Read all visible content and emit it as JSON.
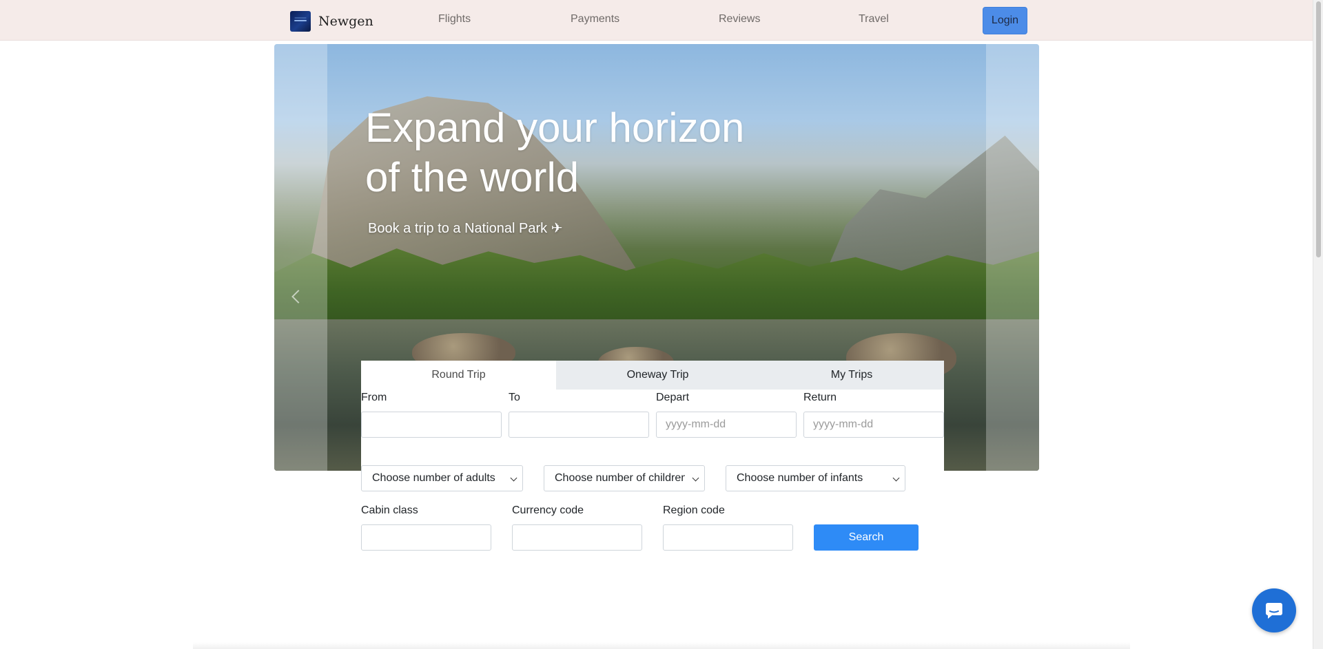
{
  "navbar": {
    "brand": "Newgen",
    "links": [
      "Flights",
      "Payments",
      "Reviews",
      "Travel"
    ],
    "login_label": "Login"
  },
  "hero": {
    "title": "Expand your horizon of the world",
    "subtitle": "Book a trip to a National Park ✈"
  },
  "booking": {
    "tabs": [
      "Round Trip",
      "Oneway Trip",
      "My Trips"
    ],
    "active_tab": "Round Trip",
    "from": {
      "label": "From",
      "value": "",
      "placeholder": ""
    },
    "to": {
      "label": "To",
      "value": "",
      "placeholder": ""
    },
    "depart": {
      "label": "Depart",
      "placeholder": "yyyy-mm-dd"
    },
    "return": {
      "label": "Return",
      "placeholder": "yyyy-mm-dd"
    },
    "adults_select": "Choose number of adults",
    "children_select": "Choose number of children",
    "infants_select": "Choose number of infants",
    "cabin_class": {
      "label": "Cabin class",
      "value": ""
    },
    "currency_code": {
      "label": "Currency code",
      "value": ""
    },
    "region_code": {
      "label": "Region code",
      "value": ""
    },
    "search_label": "Search"
  },
  "colors": {
    "navbar_bg": "#f5ebe9",
    "login_bg": "#4c8ce8",
    "search_bg": "#2e8bf6",
    "chat_bg": "#1f6fd6"
  },
  "icons": {
    "brand": "airline-logo-icon",
    "chat": "chat-bubble-icon",
    "carousel_prev": "chevron-left-icon"
  }
}
